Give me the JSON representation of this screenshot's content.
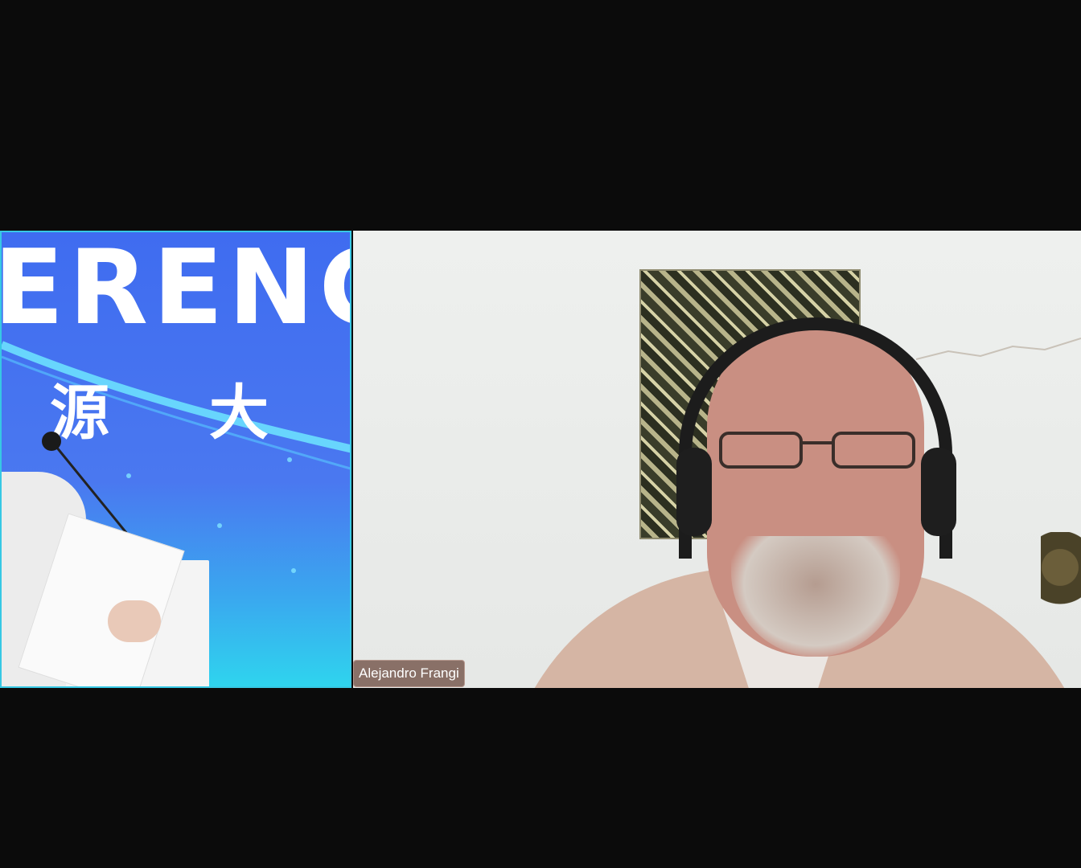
{
  "meeting": {
    "tiles": [
      {
        "id": "conference-stage",
        "banner_text": "ERENC",
        "cjk_left": "源",
        "cjk_right": "大",
        "active_speaker": true
      },
      {
        "id": "participant",
        "name_label": "Alejandro Frangi"
      }
    ]
  },
  "colors": {
    "background": "#0b0b0b",
    "active_speaker_border": "#37c8e4",
    "stage_blue": "#4a78f0",
    "name_tag_bg": "#785a50"
  }
}
